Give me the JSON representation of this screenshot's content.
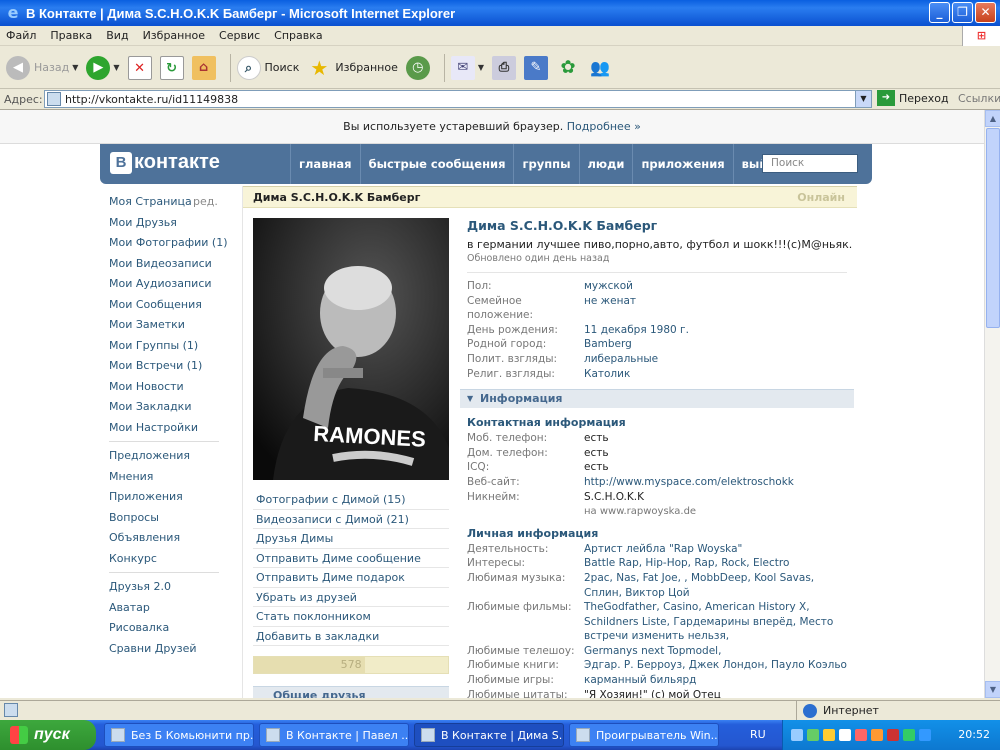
{
  "window": {
    "title": "В Контакте | Дима S.C.H.O.K.K Бамберг - Microsoft Internet Explorer",
    "min": "_",
    "max": "❐",
    "close": "✕"
  },
  "menubar": [
    "Файл",
    "Правка",
    "Вид",
    "Избранное",
    "Сервис",
    "Справка"
  ],
  "toolbar": {
    "back_label": "Назад",
    "search_label": "Поиск",
    "favorites_label": "Избранное"
  },
  "addressbar": {
    "label": "Адрес:",
    "url": "http://vkontakte.ru/id11149838",
    "go_label": "Переход",
    "links_label": "Ссылки"
  },
  "notice": {
    "text": "Вы используете устаревший браузер.",
    "link": "Подробнее »"
  },
  "vk": {
    "logo": "контакте",
    "nav": [
      "главная",
      "быстрые сообщения",
      "группы",
      "люди",
      "приложения",
      "выйти"
    ],
    "search_placeholder": "Поиск"
  },
  "leftmenu": {
    "group1": [
      "Моя Страница",
      "Мои Друзья",
      "Мои Фотографии (1)",
      "Мои Видеозаписи",
      "Мои Аудиозаписи",
      "Мои Сообщения",
      "Мои Заметки",
      "Мои Группы (1)",
      "Мои Встречи (1)",
      "Мои Новости",
      "Мои Закладки",
      "Мои Настройки"
    ],
    "edit": "ред.",
    "group2": [
      "Предложения",
      "Мнения",
      "Приложения",
      "Вопросы",
      "Объявления",
      "Конкурс"
    ],
    "group3": [
      "Друзья 2.0",
      "Аватар",
      "Рисовалка",
      "Сравни Друзей"
    ]
  },
  "profile": {
    "header_name": "Дима S.C.H.O.K.K Бамберг",
    "online": "Онлайн",
    "name": "Дима S.C.H.O.K.K Бамберг",
    "status": "в германии лучшее пиво,порно,авто, футбол и шокк!!!(с)М@ньяк.",
    "updated": "Обновлено один день назад",
    "basic": [
      {
        "k": "Пол:",
        "v": "мужской"
      },
      {
        "k": "Семейное положение:",
        "v": "не женат"
      },
      {
        "k": "День рождения:",
        "v": "11 декабря 1980 г."
      },
      {
        "k": "Родной город:",
        "v": "Bamberg"
      },
      {
        "k": "Полит. взгляды:",
        "v": "либеральные"
      },
      {
        "k": "Религ. взгляды:",
        "v": "Католик"
      }
    ],
    "info_section": "Информация",
    "contact_title": "Контактная информация",
    "contact": [
      {
        "k": "Моб. телефон:",
        "v": "есть"
      },
      {
        "k": "Дом. телефон:",
        "v": "есть"
      },
      {
        "k": "ICQ:",
        "v": "есть"
      },
      {
        "k": "Веб-сайт:",
        "v": "http://www.myspace.com/elektroschokk"
      },
      {
        "k": "Никнейм:",
        "v": "S.C.H.O.K.K",
        "sub": "на www.rapwoyska.de"
      }
    ],
    "personal_title": "Личная информация",
    "personal": [
      {
        "k": "Деятельность:",
        "v": "Артист лейбла \"Rap Woyska\""
      },
      {
        "k": "Интересы:",
        "v": "Battle Rap, Hip-Hop, Rap, Rock, Electro"
      },
      {
        "k": "Любимая музыка:",
        "v": "2pac, Nas, Fat Joe, , MobbDeep, Kool Savas, Сплин, Виктор Цой"
      },
      {
        "k": "Любимые фильмы:",
        "v": "TheGodfather, Casino, American History X, Schildners Liste, Гардемарины вперёд, Место встречи изменить нельзя,"
      },
      {
        "k": "Любимые телешоу:",
        "v": "Germanys next Topmodel,"
      },
      {
        "k": "Любимые книги:",
        "v": "Эдгар. Р. Берроуз, Джек Лондон, Пауло Коэльо"
      },
      {
        "k": "Любимые игры:",
        "v": "карманный бильярд"
      },
      {
        "k": "Любимые цитаты:",
        "v": "\"Я Хозяин!\" (с) мой Отец"
      }
    ],
    "actions": [
      "Фотографии с Димой (15)",
      "Видеозаписи с Димой (21)",
      "Друзья Димы",
      "Отправить Диме сообщение",
      "Отправить Диме подарок",
      "Убрать из друзей",
      "Стать поклонником",
      "Добавить в закладки"
    ],
    "rating": "578",
    "rating_fraction": 0.57,
    "common_friends": "Общие друзья",
    "photo_text": "RAMONES"
  },
  "statusbar": {
    "zone": "Интернет"
  },
  "taskbar": {
    "start": "пуск",
    "tasks": [
      "Без Б Комьюнити пр...",
      "В Контакте | Павел ...",
      "В Контакте | Дима S...",
      "Проигрыватель Win..."
    ],
    "lang": "RU",
    "clock": "20:52"
  }
}
